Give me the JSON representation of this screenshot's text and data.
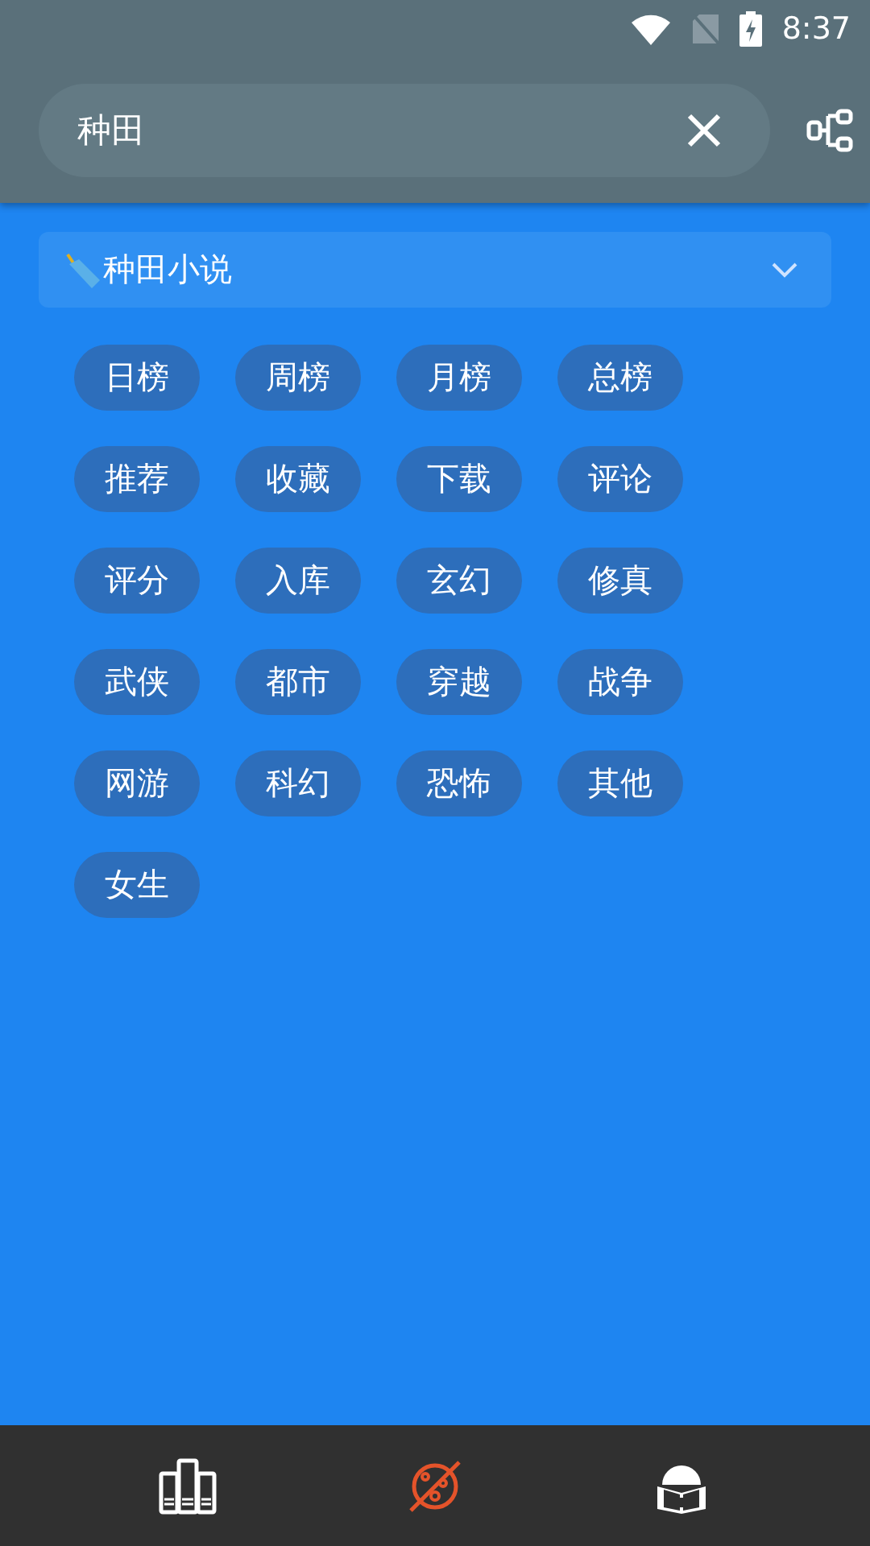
{
  "status_bar": {
    "time": "8:37"
  },
  "search": {
    "value": "种田"
  },
  "category": {
    "label": "种田小说",
    "expanded": false
  },
  "tags": [
    {
      "label": "日榜"
    },
    {
      "label": "周榜"
    },
    {
      "label": "月榜"
    },
    {
      "label": "总榜"
    },
    {
      "label": "推荐"
    },
    {
      "label": "收藏"
    },
    {
      "label": "下载"
    },
    {
      "label": "评论"
    },
    {
      "label": "评分"
    },
    {
      "label": "入库"
    },
    {
      "label": "玄幻"
    },
    {
      "label": "修真"
    },
    {
      "label": "武侠"
    },
    {
      "label": "都市"
    },
    {
      "label": "穿越"
    },
    {
      "label": "战争"
    },
    {
      "label": "网游"
    },
    {
      "label": "科幻"
    },
    {
      "label": "恐怖"
    },
    {
      "label": "其他"
    },
    {
      "label": "女生"
    }
  ],
  "bottom_nav": [
    {
      "kind": "shelf",
      "selected": false
    },
    {
      "kind": "explore",
      "selected": true
    },
    {
      "kind": "profile",
      "selected": false
    }
  ]
}
